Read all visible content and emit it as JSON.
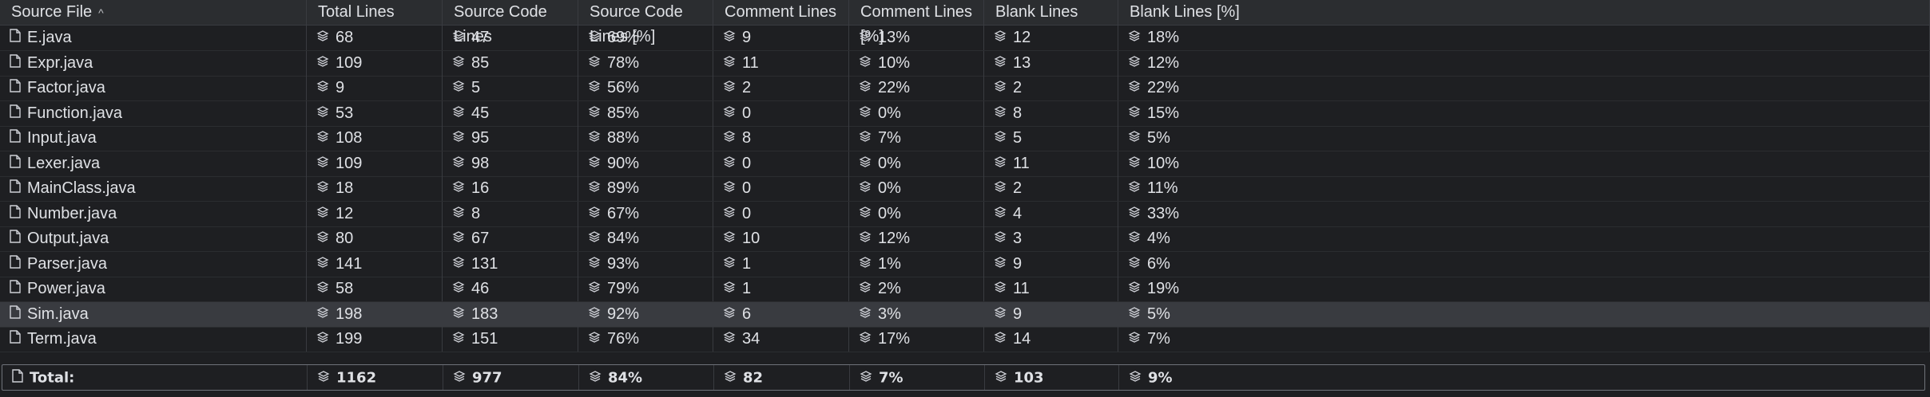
{
  "columns": [
    {
      "key": "file",
      "label": "Source File",
      "sort": "ascending"
    },
    {
      "key": "total",
      "label": "Total Lines"
    },
    {
      "key": "src",
      "label": "Source Code Lines"
    },
    {
      "key": "srcp",
      "label": "Source Code Lines [%]"
    },
    {
      "key": "com",
      "label": "Comment Lines"
    },
    {
      "key": "comp",
      "label": "Comment Lines [%]"
    },
    {
      "key": "blank",
      "label": "Blank Lines"
    },
    {
      "key": "blankp",
      "label": "Blank Lines [%]"
    }
  ],
  "sort_indicator": "^",
  "rows": [
    {
      "file": "E.java",
      "total": "68",
      "src": "47",
      "srcp": "69%",
      "com": "9",
      "comp": "13%",
      "blank": "12",
      "blankp": "18%"
    },
    {
      "file": "Expr.java",
      "total": "109",
      "src": "85",
      "srcp": "78%",
      "com": "11",
      "comp": "10%",
      "blank": "13",
      "blankp": "12%"
    },
    {
      "file": "Factor.java",
      "total": "9",
      "src": "5",
      "srcp": "56%",
      "com": "2",
      "comp": "22%",
      "blank": "2",
      "blankp": "22%"
    },
    {
      "file": "Function.java",
      "total": "53",
      "src": "45",
      "srcp": "85%",
      "com": "0",
      "comp": "0%",
      "blank": "8",
      "blankp": "15%"
    },
    {
      "file": "Input.java",
      "total": "108",
      "src": "95",
      "srcp": "88%",
      "com": "8",
      "comp": "7%",
      "blank": "5",
      "blankp": "5%"
    },
    {
      "file": "Lexer.java",
      "total": "109",
      "src": "98",
      "srcp": "90%",
      "com": "0",
      "comp": "0%",
      "blank": "11",
      "blankp": "10%"
    },
    {
      "file": "MainClass.java",
      "total": "18",
      "src": "16",
      "srcp": "89%",
      "com": "0",
      "comp": "0%",
      "blank": "2",
      "blankp": "11%"
    },
    {
      "file": "Number.java",
      "total": "12",
      "src": "8",
      "srcp": "67%",
      "com": "0",
      "comp": "0%",
      "blank": "4",
      "blankp": "33%"
    },
    {
      "file": "Output.java",
      "total": "80",
      "src": "67",
      "srcp": "84%",
      "com": "10",
      "comp": "12%",
      "blank": "3",
      "blankp": "4%"
    },
    {
      "file": "Parser.java",
      "total": "141",
      "src": "131",
      "srcp": "93%",
      "com": "1",
      "comp": "1%",
      "blank": "9",
      "blankp": "6%"
    },
    {
      "file": "Power.java",
      "total": "58",
      "src": "46",
      "srcp": "79%",
      "com": "1",
      "comp": "2%",
      "blank": "11",
      "blankp": "19%"
    },
    {
      "file": "Sim.java",
      "total": "198",
      "src": "183",
      "srcp": "92%",
      "com": "6",
      "comp": "3%",
      "blank": "9",
      "blankp": "5%",
      "selected": true
    },
    {
      "file": "Term.java",
      "total": "199",
      "src": "151",
      "srcp": "76%",
      "com": "34",
      "comp": "17%",
      "blank": "14",
      "blankp": "7%"
    }
  ],
  "total": {
    "file": "Total:",
    "total": "1162",
    "src": "977",
    "srcp": "84%",
    "com": "82",
    "comp": "7%",
    "blank": "103",
    "blankp": "9%"
  },
  "icons": {
    "file_column": "file-icon",
    "value_columns": "layers-icon"
  },
  "colors": {
    "background": "#1e1f22",
    "header": "#2b2d30",
    "selected_row": "#393b40",
    "text": "#dfe1e5"
  }
}
